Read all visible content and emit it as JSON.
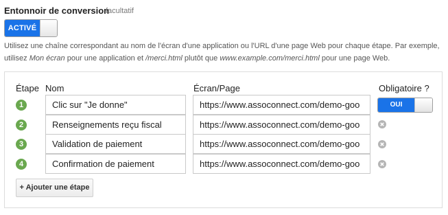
{
  "section": {
    "title": "Entonnoir de conversion",
    "optional_label": "facultatif",
    "toggle_label": "ACTIVÉ"
  },
  "help": {
    "part1": "Utilisez une chaîne correspondant au nom de l'écran d'une application ou l'URL d'une page Web pour chaque étape. Par exemple, utilisez ",
    "example_screen": "Mon écran",
    "part2": " pour une application et ",
    "example_page": "/merci.html",
    "part3": " plutôt que ",
    "example_url": "www.example.com/merci.html",
    "part4": " pour une page Web."
  },
  "table": {
    "headers": {
      "step": "Étape",
      "name": "Nom",
      "screen": "Écran/Page",
      "required": "Obligatoire ?"
    },
    "required_toggle_label": "OUI",
    "rows": [
      {
        "num": "1",
        "name": "Clic sur \"Je donne\"",
        "url": "https://www.assoconnect.com/demo-goo"
      },
      {
        "num": "2",
        "name": "Renseignements reçu fiscal",
        "url": "https://www.assoconnect.com/demo-goo"
      },
      {
        "num": "3",
        "name": "Validation de paiement",
        "url": "https://www.assoconnect.com/demo-goo"
      },
      {
        "num": "4",
        "name": "Confirmation de paiement",
        "url": "https://www.assoconnect.com/demo-goo"
      }
    ]
  },
  "add_step_label": "+ Ajouter une étape",
  "colors": {
    "accent": "#1a73e8",
    "step_circle": "#6aa84f",
    "remove_icon": "#b5b5b5"
  }
}
